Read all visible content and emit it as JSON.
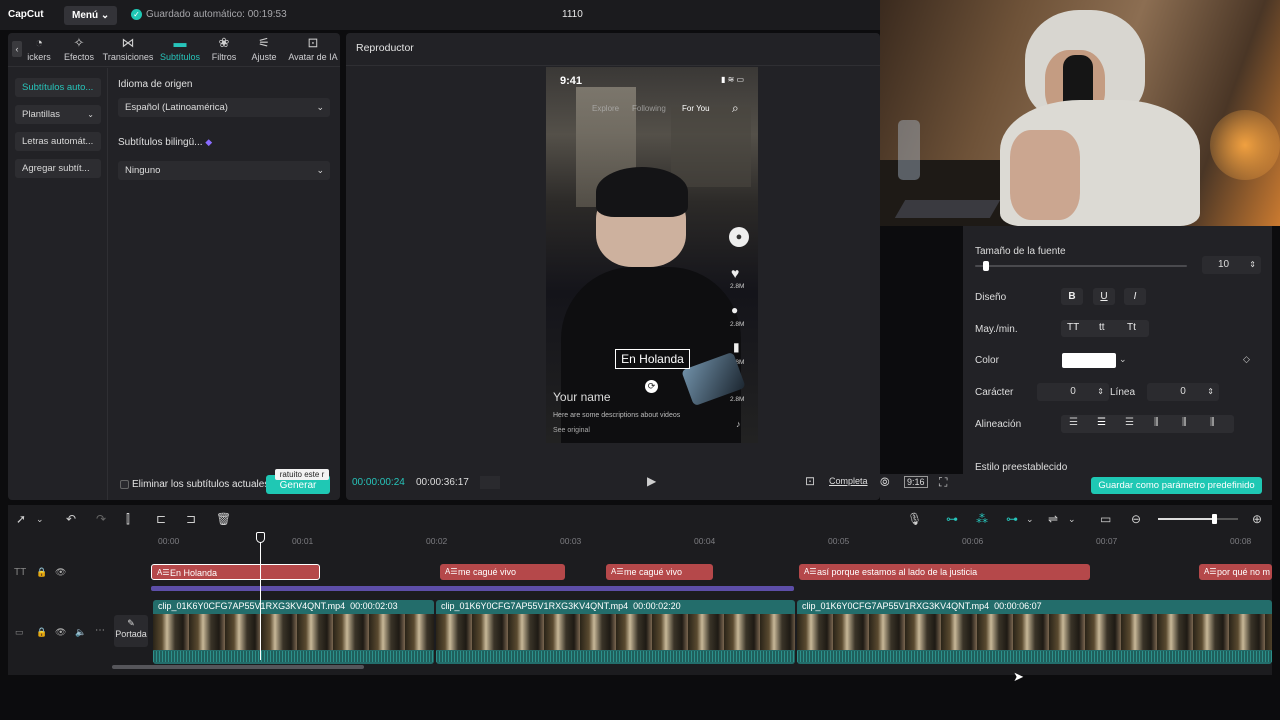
{
  "app": {
    "logo": "CapCut",
    "menu_label": "Menú",
    "autosave": "Guardado automático: 00:19:53",
    "project_title": "1110"
  },
  "tabs": [
    {
      "label": "ickers",
      "icon": "stickers-icon"
    },
    {
      "label": "Efectos",
      "icon": "effects-icon"
    },
    {
      "label": "Transiciones",
      "icon": "transitions-icon"
    },
    {
      "label": "Subtítulos",
      "icon": "subtitles-icon"
    },
    {
      "label": "Filtros",
      "icon": "filters-icon"
    },
    {
      "label": "Ajuste",
      "icon": "adjust-icon"
    },
    {
      "label": "Avatar de IA",
      "icon": "avatar-icon"
    }
  ],
  "subnav": [
    "Subtítulos auto...",
    "Plantillas",
    "Letras automát...",
    "Agregar subtít..."
  ],
  "caption_form": {
    "source_lang_label": "Idioma de origen",
    "source_lang_value": "Español (Latinoamérica)",
    "bilingual_label": "Subtítulos bilingü...",
    "bilingual_value": "Ninguno",
    "remove_label": "Eliminar los subtítulos actuales",
    "tooltip": "ratuito este r",
    "generate": "Generar"
  },
  "player": {
    "title": "Reproductor",
    "current_time": "00:00:00:24",
    "total_time": "00:00:36:17",
    "full_label": "Completa",
    "ratio": "9:16",
    "phone": {
      "time": "9:41",
      "tabs": [
        "Explore",
        "Following",
        "For You"
      ],
      "caption": "En Holanda",
      "name": "Your name",
      "desc": "Here are some descriptions about videos",
      "see": "See original",
      "counts": [
        "2.8M",
        "2.8M",
        "2.8M",
        "2.8M"
      ]
    }
  },
  "text_props": {
    "font_size_label": "Tamaño de la fuente",
    "font_size": "10",
    "font_size_fraction": 0.05,
    "design_label": "Diseño",
    "case_label": "May./min.",
    "case_opts": [
      "TT",
      "tt",
      "Tt"
    ],
    "color_label": "Color",
    "char_label": "Carácter",
    "char_value": "0",
    "line_label": "Línea",
    "line_value": "0",
    "align_label": "Alineación",
    "preset_label": "Estilo preestablecido",
    "save_preset": "Guardar como parámetro predefinido"
  },
  "timeline": {
    "ruler": [
      "00:00",
      "00:01",
      "00:02",
      "00:03",
      "00:04",
      "00:05",
      "00:06",
      "00:07",
      "00:08"
    ],
    "text_clips": [
      "En Holanda",
      "me cagué vivo",
      "me cagué vivo",
      "así porque estamos al lado de la justicia",
      "por qué no m"
    ],
    "cover_label": "Portada",
    "video_clips": [
      {
        "name": "clip_01K6Y0CFG7AP55V1RXG3KV4QNT.mp4",
        "duration": "00:00:02:03"
      },
      {
        "name": "clip_01K6Y0CFG7AP55V1RXG3KV4QNT.mp4",
        "duration": "00:00:02:20"
      },
      {
        "name": "clip_01K6Y0CFG7AP55V1RXG3KV4QNT.mp4",
        "duration": "00:00:06:07"
      }
    ],
    "zoom_fraction": 0.7
  },
  "colors": {
    "accent": "#1fc8b4",
    "text_clip": "#b5484a",
    "video_clip": "#236d6b"
  }
}
